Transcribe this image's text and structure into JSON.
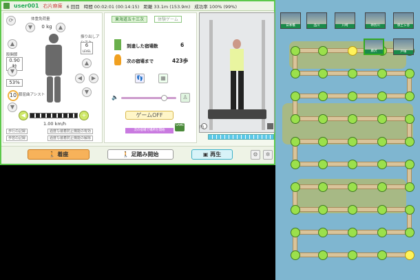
{
  "topbar": {
    "user": "user001",
    "name": "右片麻痺",
    "session": "6 回目",
    "time": "時間 00:02:01 (00:14:15)",
    "distance": "距離 33.1m (153.9m)",
    "success": "成功率 100% (99%)"
  },
  "left": {
    "weight_label": "体重免荷量",
    "weight_value": "0",
    "weight_unit": "kg",
    "hip_label": "股関節",
    "hip_value": "0.90",
    "hip_unit": "秒",
    "knee_value": "53",
    "knee_unit": "%",
    "assist_label": "振り出しアシスト",
    "assist_level": "6",
    "assist_level_unit": "LEVEL",
    "flex_label": "膝屈曲アシスト",
    "flex_value": "10",
    "speed": "1.00",
    "speed_unit": "km/h",
    "btn_history1": "歩行の記録",
    "btn_history2": "歩容の記録",
    "btn_record1": "過度な装着防止機能の有効",
    "btn_record2": "過度な装着防止機能の解除"
  },
  "middle": {
    "tab_active": "東海道五十三次",
    "tab_other": "体験ゲーム",
    "stat1_label": "到達した宿場数",
    "stat1_value": "6",
    "stat2_label": "次の宿場まで",
    "stat2_value": "423歩",
    "game_button": "ゲームOFF",
    "footer_note": "次の宿場で場所を開始",
    "game_badge": "GAME"
  },
  "video": {
    "label": "FB"
  },
  "bottom": {
    "seat_button": "着座",
    "step_button": "足踏み開始",
    "play_button": "再生"
  },
  "map": {
    "stations": [
      "日本橋",
      "品川",
      "川崎",
      "神奈川",
      "保土ヶ谷",
      "戸塚",
      "藤沢"
    ]
  },
  "colors": {
    "accent": "#5cc84a",
    "node": "#9be04c",
    "current_node": "#fff35a",
    "water": "#7fb6d0"
  }
}
